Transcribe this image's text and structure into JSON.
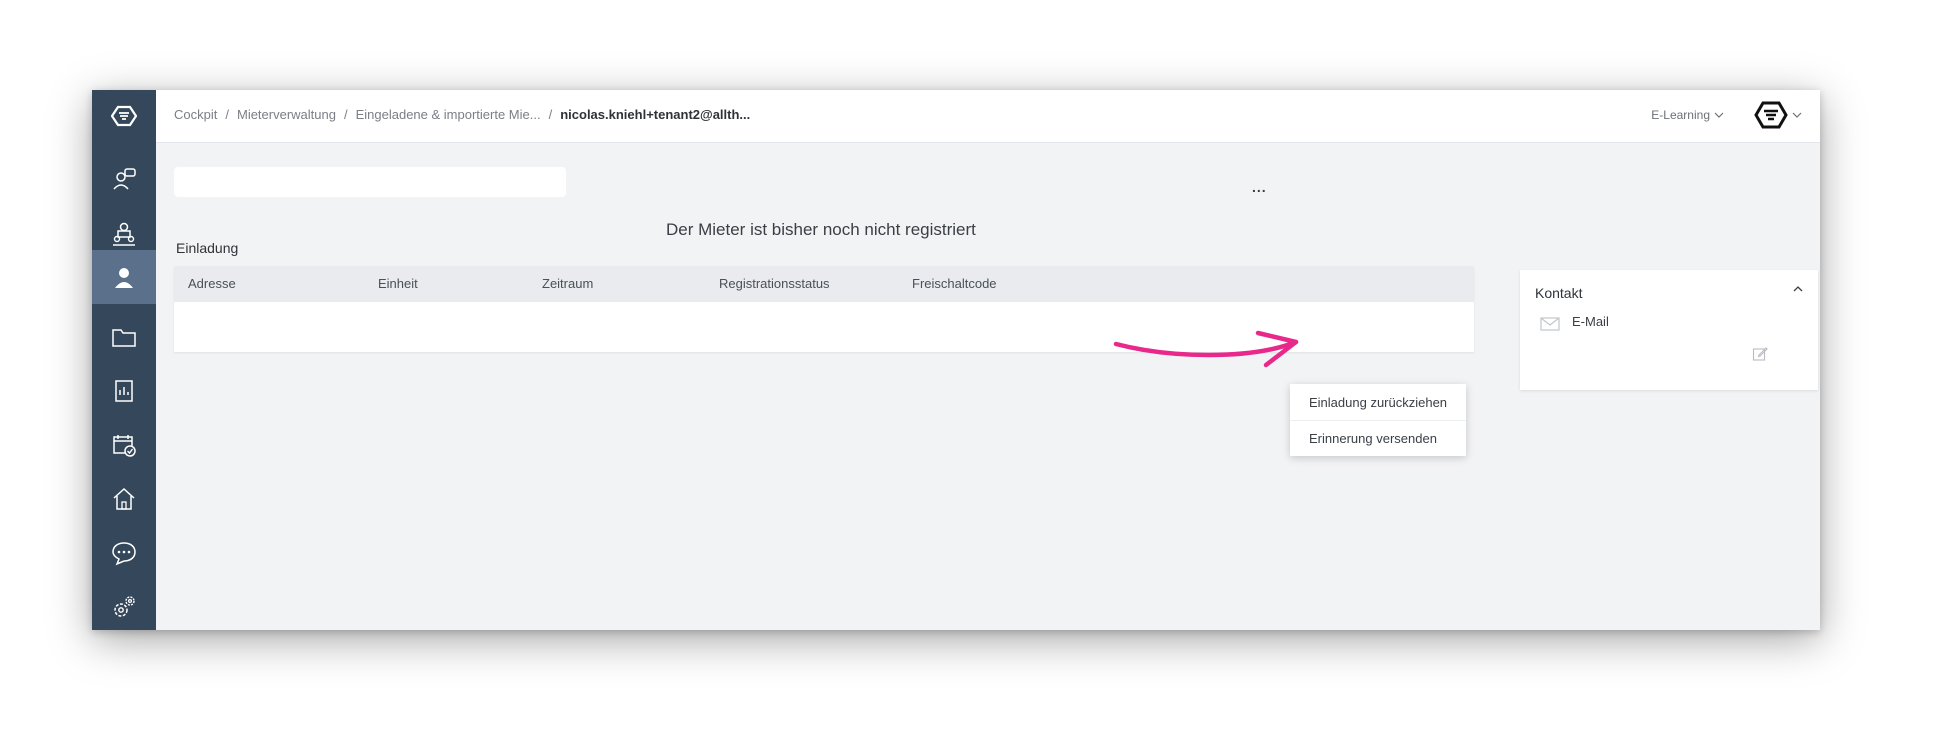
{
  "breadcrumb": {
    "items": [
      "Cockpit",
      "Mieterverwaltung",
      "Eingeladene & importierte Mie...",
      "nicolas.kniehl+tenant2@allth..."
    ],
    "separator": "/"
  },
  "header": {
    "elearning_label": "E-Learning"
  },
  "main": {
    "notice": "Der Mieter ist bisher noch nicht registriert",
    "section_title": "Einladung",
    "table": {
      "columns": [
        "Adresse",
        "Einheit",
        "Zeitraum",
        "Registrationsstatus",
        "Freischaltcode"
      ],
      "more_label": "..."
    },
    "menu": {
      "items": [
        "Einladung zurückziehen",
        "Erinnerung versenden"
      ]
    }
  },
  "contact": {
    "title": "Kontakt",
    "email_label": "E-Mail"
  },
  "sidebar": {
    "icons": [
      "logo-icon",
      "presenter-icon",
      "team-icon",
      "tenant-icon",
      "folder-icon",
      "report-icon",
      "calendar-check-icon",
      "home-icon",
      "chat-icon",
      "settings-icon"
    ],
    "active_index": 3
  },
  "colors": {
    "sidebar": "#35475b",
    "sidebar_active": "#5b708a",
    "annotation_arrow": "#e8288a"
  }
}
